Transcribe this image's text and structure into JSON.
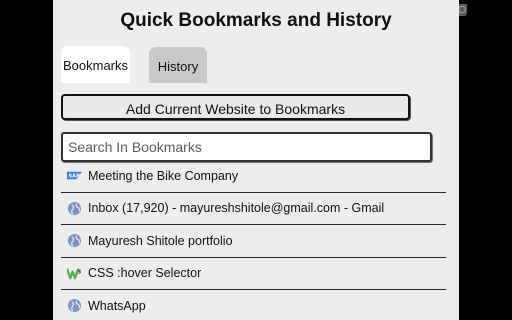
{
  "title": "Quick Bookmarks and History",
  "tabs": [
    {
      "label": "Bookmarks",
      "active": true
    },
    {
      "label": "History",
      "active": false
    }
  ],
  "add_button": "Add Current Website to Bookmarks",
  "search": {
    "placeholder": "Search In Bookmarks",
    "value": ""
  },
  "bookmarks": [
    {
      "label": "Meeting the Bike Company",
      "icon": "sap-icon"
    },
    {
      "label": "Inbox (17,920) - mayureshshitole@gmail.com - Gmail",
      "icon": "globe-icon"
    },
    {
      "label": "Mayuresh Shitole portfolio",
      "icon": "globe-icon"
    },
    {
      "label": "CSS :hover Selector",
      "icon": "w3schools-icon"
    },
    {
      "label": "WhatsApp",
      "icon": "globe-icon"
    }
  ],
  "colors": {
    "popup_background": "#ededed",
    "active_tab": "#ffffff",
    "inactive_tab": "#c9c9c9",
    "globe_icon": "#7f95c4",
    "sap_icon": "#3a7bd5",
    "w3schools_icon": "#4caf50"
  }
}
